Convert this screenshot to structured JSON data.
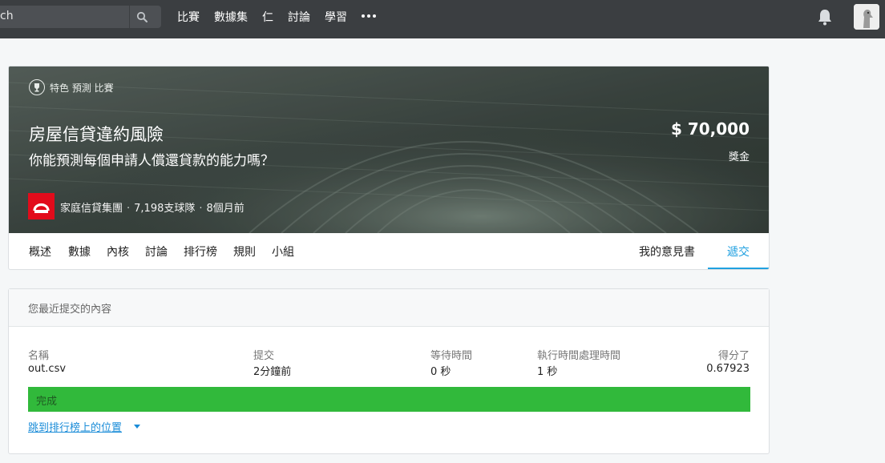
{
  "nav": {
    "search_text": "ch",
    "links": [
      "比賽",
      "數據集",
      "仁",
      "討論",
      "學習"
    ],
    "more_icon": "more-icon",
    "bell_icon": "bell-icon",
    "avatar_icon": "user-avatar"
  },
  "competition": {
    "tag": "特色 預測 比賽",
    "title": "房屋信貸違約風險",
    "subtitle": "你能預測每個申請人償還貸款的能力嗎？",
    "prize_amount": "$ 70,000",
    "prize_label": "獎金",
    "host": "家庭信貸集團",
    "teams": "7,198支球隊",
    "time": "8個月前",
    "tabs": [
      "概述",
      "數據",
      "內核",
      "討論",
      "排行榜",
      "規則",
      "小組"
    ],
    "right_tabs": [
      "我的意見書",
      "遞交"
    ],
    "active_tab": "遞交",
    "colors": {
      "accent": "#20a0e0",
      "host_logo": "#e20b1b",
      "nav_bg": "#3b3e41"
    }
  },
  "submission": {
    "panel_title": "您最近提交的內容",
    "headers": [
      "名稱",
      "提交",
      "等待時間",
      "執行時間處理時間",
      "得分了"
    ],
    "values": [
      "out.csv",
      "2分鐘前",
      "0 秒",
      "1 秒",
      "0.67923"
    ],
    "status": "完成",
    "status_color": "#31b93b",
    "jump_link": "跳到排行榜上的位置"
  }
}
